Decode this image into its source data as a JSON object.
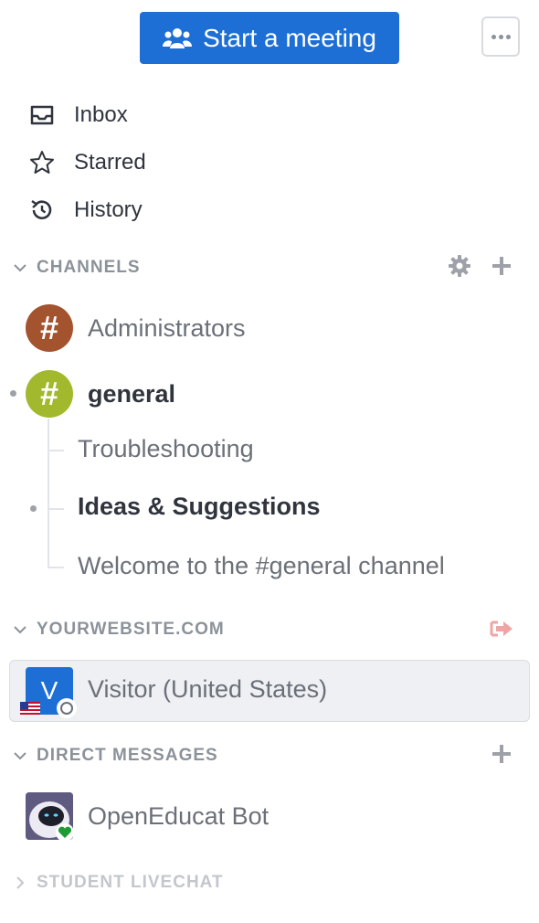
{
  "toolbar": {
    "meeting_button_label": "Start a meeting",
    "accent_color": "#1d6fd6"
  },
  "nav": [
    {
      "label": "Inbox",
      "icon": "inbox-icon"
    },
    {
      "label": "Starred",
      "icon": "star-icon"
    },
    {
      "label": "History",
      "icon": "history-icon"
    }
  ],
  "channels": {
    "header": "CHANNELS",
    "rooms": [
      {
        "name": "Administrators",
        "avatar_color": "#a4532f",
        "unread": false
      },
      {
        "name": "general",
        "avatar_color": "#a2b92e",
        "unread": true
      }
    ],
    "threads": [
      {
        "name": "Troubleshooting",
        "unread": false
      },
      {
        "name": "Ideas & Suggestions",
        "unread": true
      },
      {
        "name": "Welcome to the #general channel",
        "unread": false
      }
    ]
  },
  "website": {
    "header": "YOURWEBSITE.COM",
    "visitor": {
      "initial": "V",
      "name": "Visitor (United States)",
      "avatar_color": "#1d6fd6"
    }
  },
  "direct_messages": {
    "header": "DIRECT MESSAGES",
    "items": [
      {
        "name": "OpenEducat Bot",
        "status_color": "#1e9b34"
      }
    ]
  },
  "student_livechat": {
    "header": "STUDENT LIVECHAT"
  }
}
